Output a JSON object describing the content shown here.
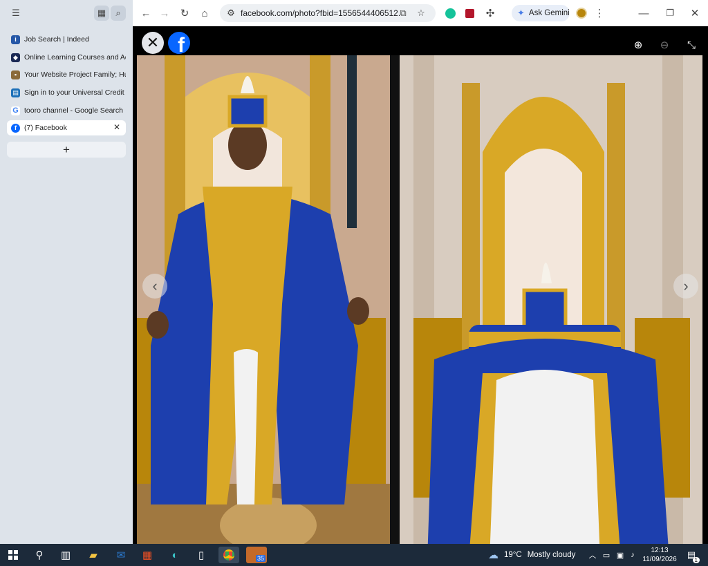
{
  "sidebar": {
    "tabs": [
      {
        "label": "Job Search | Indeed",
        "favicon": "indeed-icon",
        "color": "#2557a7"
      },
      {
        "label": "Online Learning Courses and Ad",
        "favicon": "shield-icon",
        "color": "#1b2a55"
      },
      {
        "label": "Your Website Project Family; Hut",
        "favicon": "site-icon",
        "color": "#8a6a3a"
      },
      {
        "label": "Sign in to your Universal Credit a",
        "favicon": "gov-icon",
        "color": "#1d70b8"
      },
      {
        "label": "tooro channel - Google Search",
        "favicon": "google-icon",
        "color": "#4285f4"
      },
      {
        "label": "(7) Facebook",
        "favicon": "facebook-icon",
        "color": "#0866ff",
        "active": true
      }
    ],
    "new_tab_label": "+"
  },
  "toolbar": {
    "url": "facebook.com/photo?fbid=1556544406512...",
    "ask_gemini_label": "Ask Gemini"
  },
  "viewer": {
    "close_label": "✕",
    "brand_letter": "f",
    "colors": {
      "royal_blue": "#1d3fae",
      "gold": "#d9a826",
      "white": "#f2f2f2"
    }
  },
  "taskbar": {
    "weather_temp": "19°C",
    "weather_desc": "Mostly cloudy",
    "time": "12:13",
    "date": "11/09/2026",
    "badge_count": "35",
    "notification_count": "1"
  }
}
